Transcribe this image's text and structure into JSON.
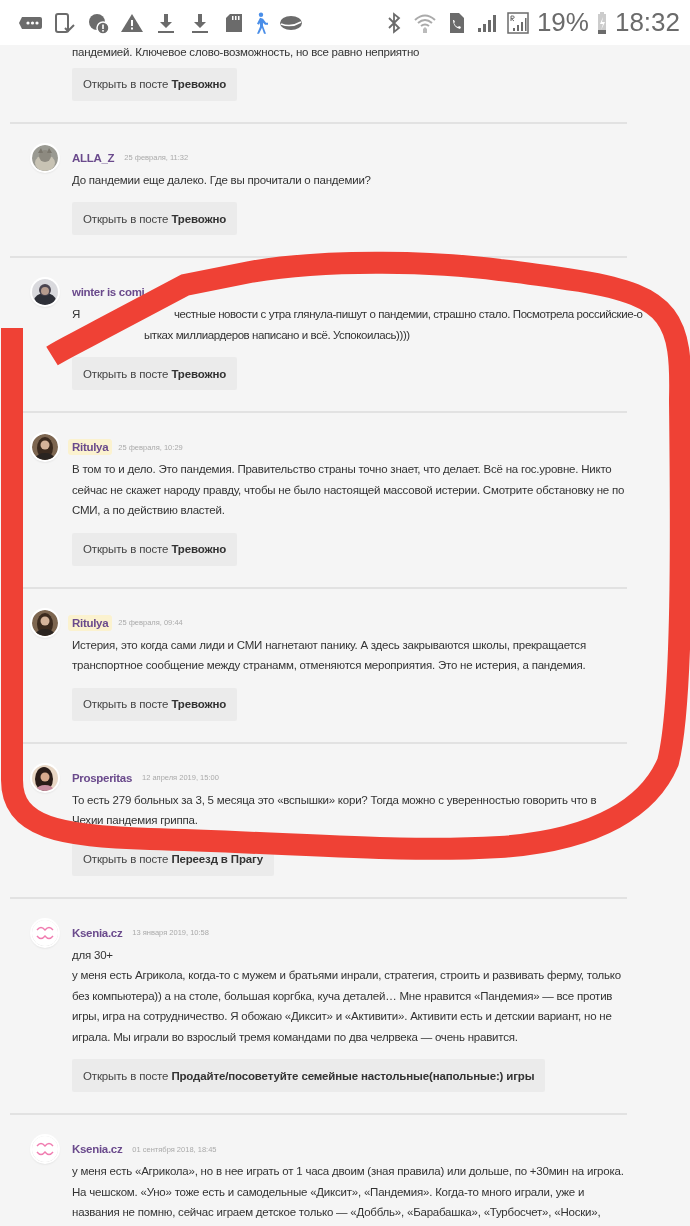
{
  "status_bar": {
    "battery": "19%",
    "time": "18:32"
  },
  "comments": [
    {
      "kind": "partial",
      "body": "пандемией. Ключевое слово-возможность, но все равно неприятно",
      "button": "Открыть в посте **Тревожно**"
    },
    {
      "kind": "full",
      "author": "ALLA_Z",
      "highlighted": false,
      "date": "25 февраля, 11:32",
      "body": "До пандемии еще далеко. Где вы прочитали о пандемии?",
      "button": "Открыть в посте **Тревожно**"
    },
    {
      "kind": "covered",
      "author": "winter is comi",
      "highlighted": false,
      "body_lines": [
        [
          "Я",
          "честные новости с утра глянула-пишут о пандемии, страшно стало. Посмотрела российские-о"
        ],
        [
          "ытках миллиардеров написано и всё. Успокоилась))))"
        ]
      ],
      "button": "Открыть в посте **Тревожно**"
    },
    {
      "kind": "full",
      "author": "Ritulya",
      "highlighted": true,
      "date": "25 февраля, 10:29",
      "body": "В том то и дело. Это пандемия. Правительство страны точно знает, что делает. Всё на гос.уровне. Никто сейчас не скажет народу правду, чтобы не было настоящей массовой истерии. Смотрите обстановку не по СМИ, а по действию властей.",
      "button": "Открыть в посте **Тревожно**"
    },
    {
      "kind": "full",
      "author": "Ritulya",
      "highlighted": true,
      "date": "25 февраля, 09:44",
      "body": "Истерия, это когда сами лиди и СМИ нагнетают панику. А здесь закрываются школы, прекращается транспортное сообщение между странамм, отменяются мероприятия. Это не истерия, а пандемия.",
      "button": "Открыть в посте **Тревожно**"
    },
    {
      "kind": "full",
      "author": "Prosperitas",
      "highlighted": false,
      "date": "12 апреля 2019, 15:00",
      "body": "То есть 279 больных за 3, 5 месяца это «вспышки» кори? Тогда можно с уверенностью говорить что в Чехии пандемия гриппа.",
      "button": "Открыть в посте **Переезд в Прагу**"
    },
    {
      "kind": "full",
      "author": "Ksenia.cz",
      "highlighted": false,
      "date": "13 января 2019, 10:58",
      "body": "для 30+\nу меня есть Агрикола, когда-то с мужем и братьями инрали, стратегия, строить и развивать ферму, только без компьютера)) а на столе, большая коргбка, куча деталей… Мне нравится «Пандемия» — все против игры, игра на сотрудничество. Я обожаю «Диксит» и «Активити». Активити есть и детскии вариант, но не играла. Мы играли во взрослый тремя командами по два челрвека — очень нравится.",
      "button": "Открыть в посте **Продайте/посоветуйте семейные настольные(напольные:) игры**"
    },
    {
      "kind": "full",
      "author": "Ksenia.cz",
      "highlighted": false,
      "date": "01 сентября 2018, 18:45",
      "body": "у меня есть «Агрикола», но в нее играть от 1 часа двоим (зная правила) или дольше, по +30мин на игрока. На чешском. «Уно» тоже есть и самодельные «Диксит», «Пандемия». Когда-то много играли, уже и названия не помню, сейчас играем детское только — «Доббль», «Барабашка», «Турбосчет», «Носки»,"
    }
  ],
  "annotation": {
    "kind": "loop"
  }
}
